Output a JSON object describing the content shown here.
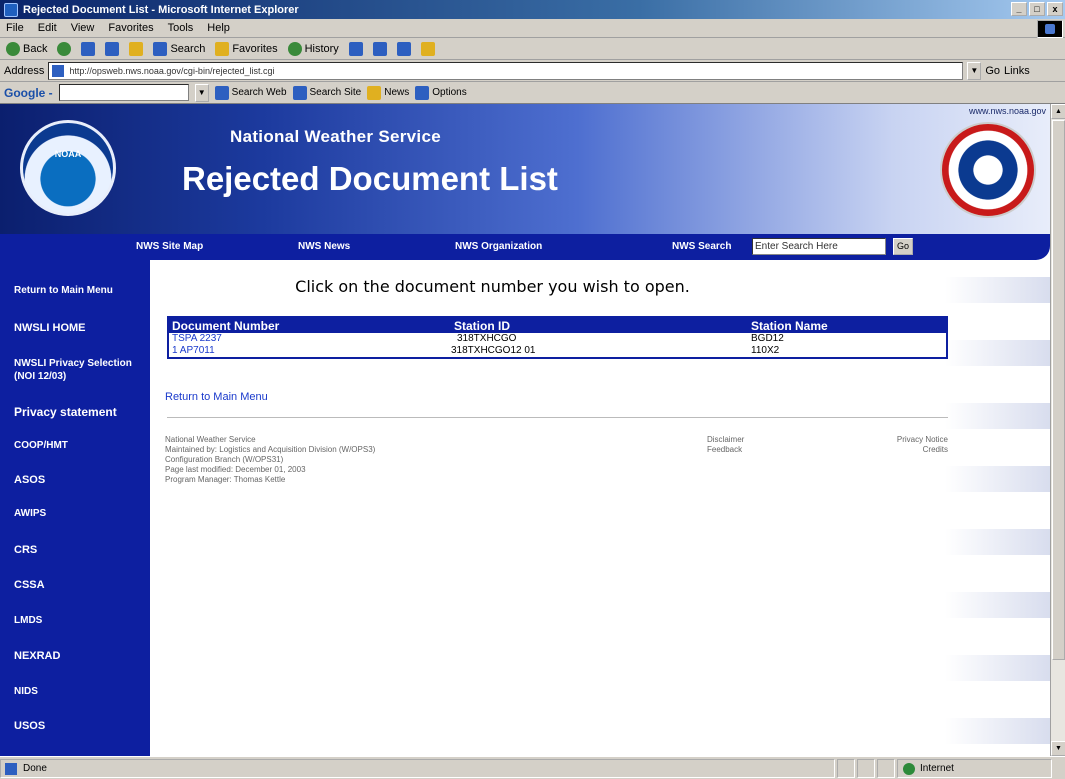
{
  "window": {
    "title": "Rejected Document List - Microsoft Internet Explorer",
    "minimize": "_",
    "maximize": "□",
    "close": "x"
  },
  "menu": [
    "File",
    "Edit",
    "View",
    "Favorites",
    "Tools",
    "Help"
  ],
  "toolbar": {
    "back": "Back",
    "search": "Search",
    "favorites": "Favorites",
    "history": "History"
  },
  "address": {
    "label": "Address",
    "url": "http://opsweb.nws.noaa.gov/cgi-bin/rejected_list.cgi",
    "go": "Go",
    "links": "Links"
  },
  "google": {
    "logo": "Google -",
    "search_web": "Search Web",
    "search_site": "Search Site",
    "news": "News",
    "options": "Options"
  },
  "page": {
    "site_url": "www.nws.noaa.gov",
    "org_title": "National Weather Service",
    "page_title": "Rejected Document List",
    "noaa_logo_text": "NOAA",
    "nav": {
      "site_map": "NWS Site Map",
      "news": "NWS News",
      "organization": "NWS Organization",
      "search_label": "NWS Search",
      "search_placeholder": "Enter Search Here",
      "go": "Go"
    },
    "sidebar": [
      "Return to Main Menu",
      "NWSLI HOME",
      "NWSLI Privacy Selection (NOI 12/03)",
      "Privacy statement",
      "COOP/HMT",
      "ASOS",
      "AWIPS",
      "CRS",
      "CSSA",
      "LMDS",
      "NEXRAD",
      "NIDS",
      "USOS"
    ],
    "instruction": "Click on the document number you wish to open.",
    "table": {
      "headers": [
        "Document Number",
        "Station ID",
        "Station Name"
      ],
      "rows": [
        [
          "TSPA 2237",
          "318TXHCGO",
          "BGD12"
        ],
        [
          "1 AP7011",
          "318TXHCGO12 01",
          "110X2"
        ]
      ]
    },
    "return_link": "Return to Main Menu",
    "footer_left": [
      "National Weather Service",
      "Maintained by: Logistics and Acquisition Division (W/OPS3)",
      "Configuration Branch (W/OPS31)",
      "Page last modified: December 01, 2003",
      "Program Manager: Thomas Kettle"
    ],
    "footer_mid": [
      "Disclaimer",
      "Feedback"
    ],
    "footer_right": [
      "Privacy Notice",
      "Credits"
    ]
  },
  "status": {
    "text": "Done",
    "zone": "Internet"
  }
}
